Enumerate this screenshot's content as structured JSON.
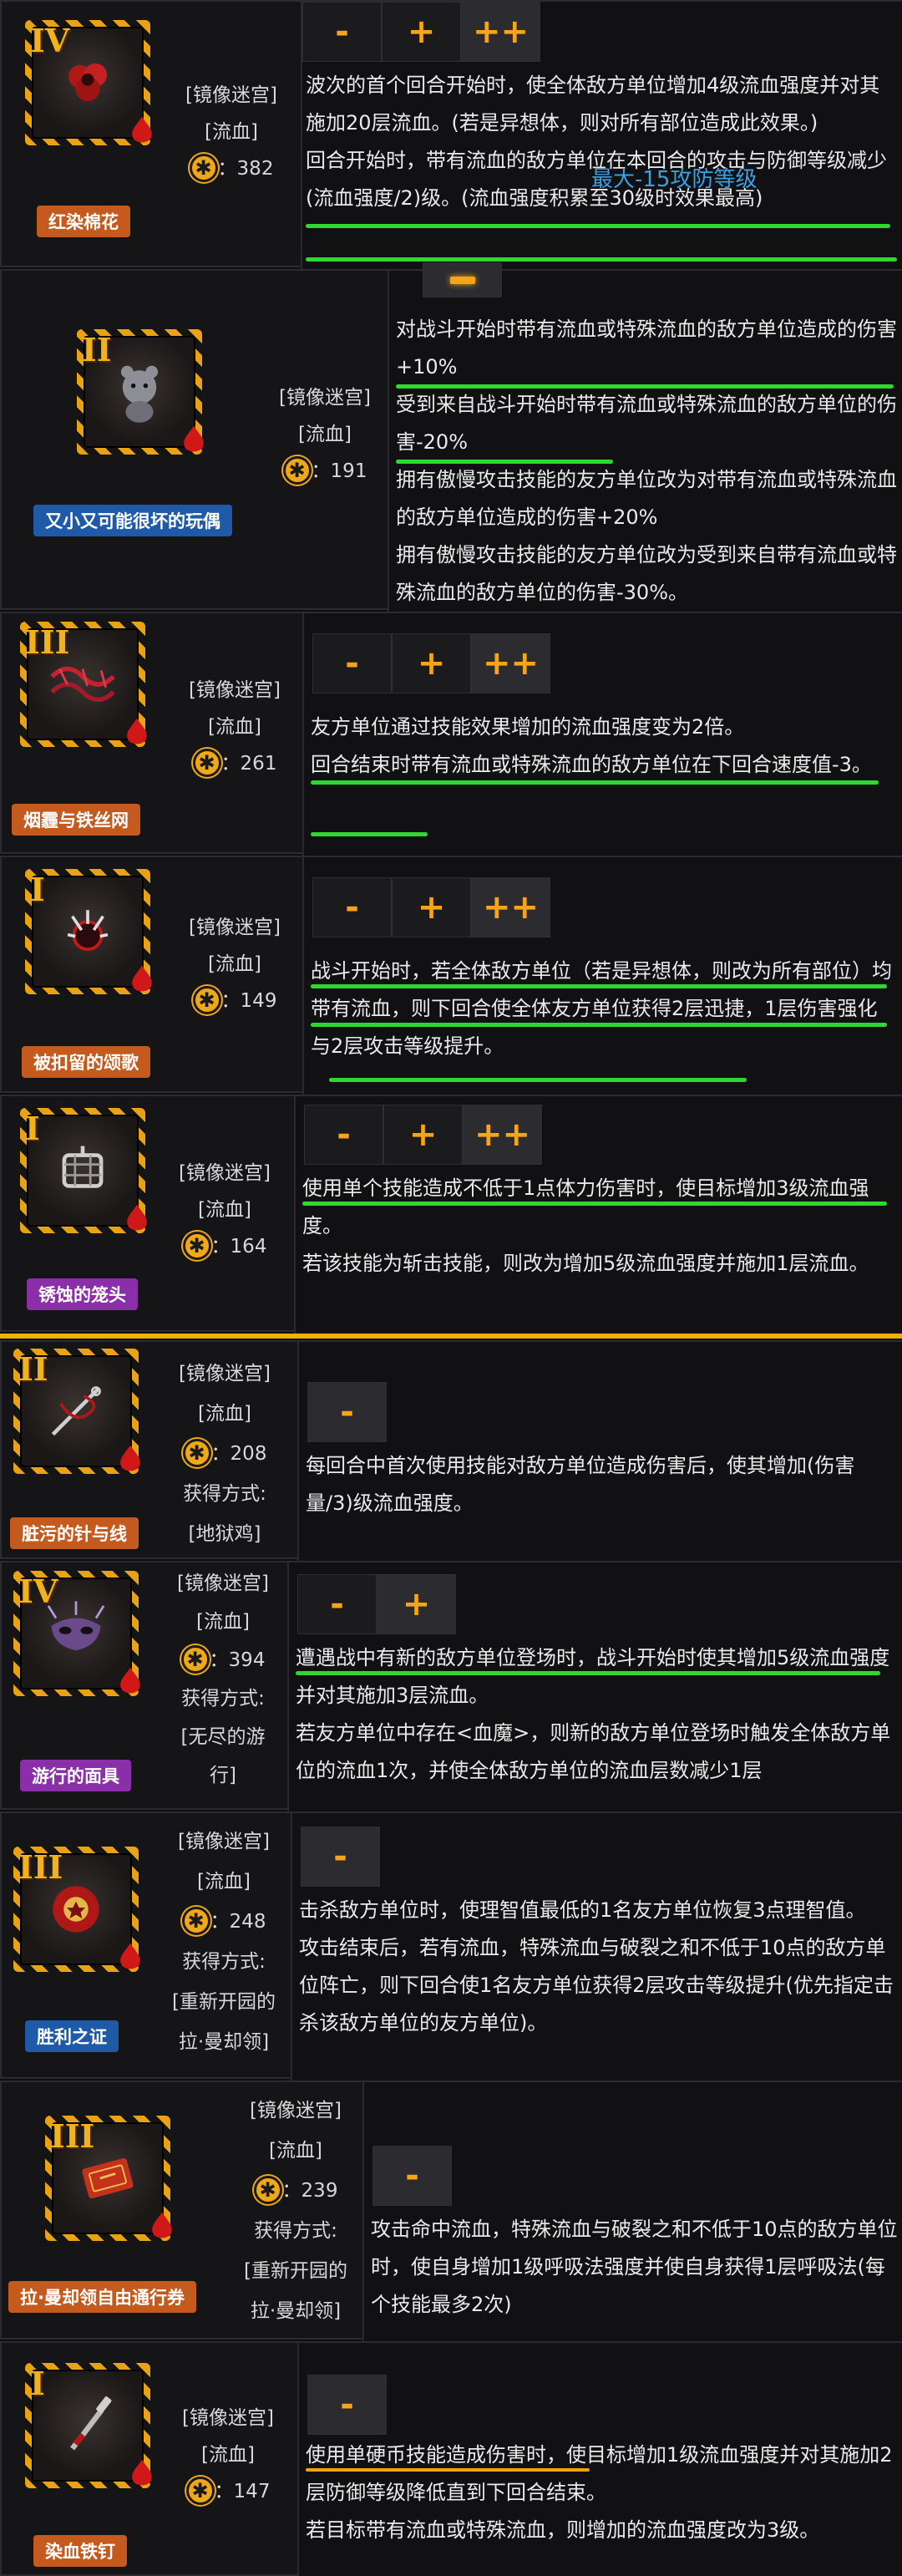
{
  "gifts": [
    {
      "tier": "IV",
      "name": "红染棉花",
      "name_color": "#c45a1e",
      "meta": [
        "[镜像迷宫]",
        "[流血]"
      ],
      "cost": "382",
      "acquire": [],
      "tabs": [
        "-",
        "+",
        "++"
      ],
      "desc": [
        "波次的首个回合开始时，使全体敌方单位增加4级流血强度并对其施加20层流血。(若是异想体，则对所有部位造成此效果。)",
        "回合开始时，带有流血的敌方单位在本回合的攻击与防御等级减少(流血强度/2)级。(流血强度积累至30级时效果最高)"
      ],
      "note": "最大-15攻防等级"
    },
    {
      "tier": "II",
      "name": "又小又可能很坏的玩偶",
      "name_color": "#1f5aa8",
      "meta": [
        "[镜像迷宫]",
        "[流血]"
      ],
      "cost": "191",
      "acquire": [],
      "tabs": [],
      "desc": [
        "对战斗开始时带有流血或特殊流血的敌方单位造成的伤害+10%",
        "受到来自战斗开始时带有流血或特殊流血的敌方单位的伤害-20%",
        "拥有傲慢攻击技能的友方单位改为对带有流血或特殊流血的敌方单位造成的伤害+20%",
        "拥有傲慢攻击技能的友方单位改为受到来自带有流血或特殊流血的敌方单位的伤害-30%。"
      ]
    },
    {
      "tier": "III",
      "name": "烟霾与铁丝网",
      "name_color": "#c45a1e",
      "meta": [
        "[镜像迷宫]",
        "[流血]"
      ],
      "cost": "261",
      "acquire": [],
      "tabs": [
        "-",
        "+",
        "++"
      ],
      "desc": [
        "友方单位通过技能效果增加的流血强度变为2倍。",
        "回合结束时带有流血或特殊流血的敌方单位在下回合速度值-3。"
      ]
    },
    {
      "tier": "I",
      "name": "被扣留的颂歌",
      "name_color": "#c45a1e",
      "meta": [
        "[镜像迷宫]",
        "[流血]"
      ],
      "cost": "149",
      "acquire": [],
      "tabs": [
        "-",
        "+",
        "++"
      ],
      "desc": [
        "战斗开始时，若全体敌方单位（若是异想体，则改为所有部位）均带有流血，则下回合使全体友方单位获得2层迅捷，1层伤害强化与2层攻击等级提升。"
      ]
    },
    {
      "tier": "I",
      "name": "锈蚀的笼头",
      "name_color": "#8a2fa8",
      "meta": [
        "[镜像迷宫]",
        "[流血]"
      ],
      "cost": "164",
      "acquire": [],
      "tabs": [
        "-",
        "+",
        "++"
      ],
      "desc": [
        "使用单个技能造成不低于1点体力伤害时，使目标增加3级流血强度。",
        "若该技能为斩击技能，则改为增加5级流血强度并施加1层流血。"
      ]
    },
    {
      "tier": "II",
      "name": "脏污的针与线",
      "name_color": "#c45a1e",
      "meta": [
        "[镜像迷宫]",
        "[流血]"
      ],
      "cost": "208",
      "acquire": [
        "获得方式:",
        "[地狱鸡]"
      ],
      "tabs": [
        "-"
      ],
      "desc": [
        "每回合中首次使用技能对敌方单位造成伤害后，使其增加(伤害量/3)级流血强度。"
      ]
    },
    {
      "tier": "IV",
      "name": "游行的面具",
      "name_color": "#8a2fa8",
      "meta": [
        "[镜像迷宫]",
        "[流血]"
      ],
      "cost": "394",
      "acquire": [
        "获得方式:",
        "[无尽的游",
        "行]"
      ],
      "tabs": [
        "-",
        "+"
      ],
      "desc": [
        "遭遇战中有新的敌方单位登场时，战斗开始时使其增加5级流血强度并对其施加3层流血。",
        "若友方单位中存在<血魔>，则新的敌方单位登场时触发全体敌方单位的流血1次，并使全体敌方单位的流血层数减少1层"
      ]
    },
    {
      "tier": "III",
      "name": "胜利之证",
      "name_color": "#1f5aa8",
      "meta": [
        "[镜像迷宫]",
        "[流血]"
      ],
      "cost": "248",
      "acquire": [
        "获得方式:",
        "[重新开园的",
        "拉·曼却领]"
      ],
      "tabs": [
        "-"
      ],
      "desc": [
        "击杀敌方单位时，使理智值最低的1名友方单位恢复3点理智值。",
        "攻击结束后，若有流血，特殊流血与破裂之和不低于10点的敌方单位阵亡，则下回合使1名友方单位获得2层攻击等级提升(优先指定击杀该敌方单位的友方单位)。"
      ]
    },
    {
      "tier": "III",
      "name": "拉·曼却领自由通行券",
      "name_color": "#c45a1e",
      "meta": [
        "[镜像迷宫]",
        "[流血]"
      ],
      "cost": "239",
      "acquire": [
        "获得方式:",
        "[重新开园的",
        "拉·曼却领]"
      ],
      "tabs": [
        "-"
      ],
      "desc": [
        "攻击命中流血，特殊流血与破裂之和不低于10点的敌方单位时，使自身增加1级呼吸法强度并使自身获得1层呼吸法(每个技能最多2次)"
      ]
    },
    {
      "tier": "I",
      "name": "染血铁钉",
      "name_color": "#c45a1e",
      "meta": [
        "[镜像迷宫]",
        "[流血]"
      ],
      "cost": "147",
      "acquire": [],
      "tabs": [
        "-"
      ],
      "desc": [
        "使用单硬币技能造成伤害时，使目标增加1级流血强度并对其施加2层防御等级降低直到下回合结束。",
        "若目标带有流血或特殊流血，则增加的流血强度改为3级。"
      ]
    }
  ],
  "colors": {
    "accent": "#f4a51a",
    "bleed": "#ff4a4a",
    "highlight_green": "#2fd82f",
    "note_blue": "#3aa0e0"
  },
  "icons": [
    "cotton-flower-icon",
    "plush-doll-icon",
    "barbed-wire-icon",
    "hymn-claw-icon",
    "rusted-bridle-icon",
    "needle-thread-icon",
    "parade-mask-icon",
    "victory-medal-icon",
    "free-pass-ticket-icon",
    "bloody-nail-icon"
  ]
}
